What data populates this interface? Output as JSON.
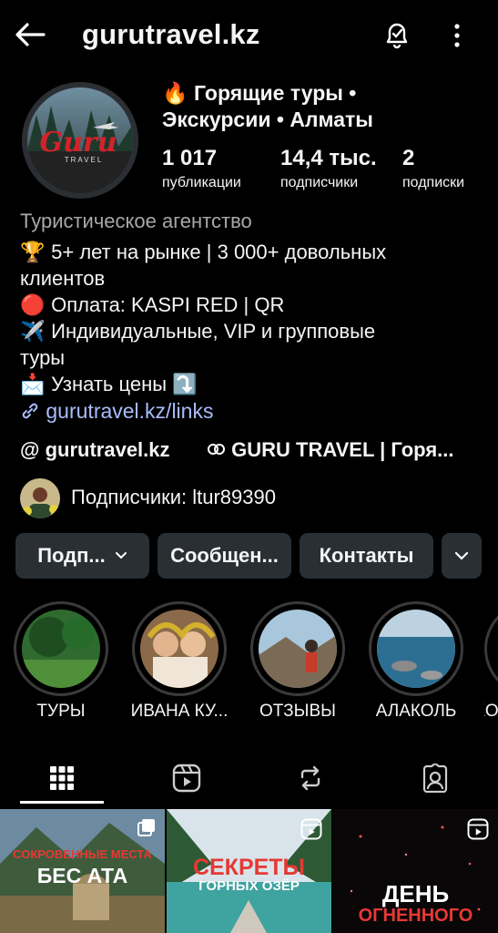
{
  "header": {
    "handle": "gurutravel.kz"
  },
  "profile": {
    "name_line1": "Горящие туры •",
    "name_line2": "Экскурсии • Алматы",
    "name_emoji": "🔥",
    "avatar_text": "Guru",
    "avatar_subtext": "TRAVEL",
    "stats": [
      {
        "value": "1 017",
        "label": "публикации"
      },
      {
        "value": "14,4 тыс.",
        "label": "подписчики"
      },
      {
        "value": "2",
        "label": "подписки"
      }
    ],
    "category": "Туристическое агентство",
    "bio": [
      {
        "emoji": "🏆",
        "text": "5+ лет на рынке | 3 000+ довольных"
      },
      {
        "emoji": "",
        "text": "клиентов"
      },
      {
        "emoji": "🔴",
        "text": "Оплата: KASPI RED | QR"
      },
      {
        "emoji": "✈️",
        "text": "Индивидуальные, VIP и групповые"
      },
      {
        "emoji": "",
        "text": "туры"
      },
      {
        "emoji": "📩",
        "text": "Узнать цены ⤵️"
      }
    ],
    "link": "gurutravel.kz/links",
    "threads_handle": "gurutravel.kz",
    "group_name": "GURU TRAVEL | Горя...",
    "followed_by": "Подписчики: ltur89390"
  },
  "buttons": {
    "follow": "Подп...",
    "message": "Сообщен...",
    "contacts": "Контакты"
  },
  "highlights": [
    {
      "label": "ТУРЫ"
    },
    {
      "label": "ИВАНА КУ..."
    },
    {
      "label": "ОТЗЫВЫ"
    },
    {
      "label": "АЛАКОЛЬ"
    },
    {
      "label": "КО"
    }
  ],
  "posts": [
    {
      "line1": "СОКРОВЕННЫЕ МЕСТА",
      "line2": "БЕС АТА"
    },
    {
      "line1": "СЕКРЕТЫ",
      "line2": "ГОРНЫХ ОЗЁР"
    },
    {
      "line1": "ДЕНЬ",
      "line2": "ОГНЕННОГО"
    }
  ],
  "colors": {
    "background": "#000000",
    "button": "#2a2f33",
    "link": "#a9bdfb",
    "accent_red": "#e53935"
  }
}
